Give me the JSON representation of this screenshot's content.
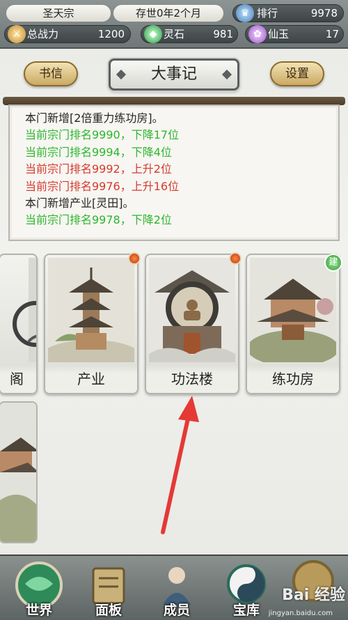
{
  "status": {
    "sect_name": "圣天宗",
    "era": "存世0年2个月",
    "rank_label": "排行",
    "rank_value": "9978",
    "power_label": "总战力",
    "power_value": "1200",
    "spirit_stone_label": "灵石",
    "spirit_stone_value": "981",
    "immortal_jade_label": "仙玉",
    "immortal_jade_value": "17"
  },
  "header": {
    "letters_label": "书信",
    "title": "大事记",
    "settings_label": "设置"
  },
  "events": [
    {
      "text": "本门新增[2倍重力练功房]。",
      "color": "black"
    },
    {
      "text": "当前宗门排名9990，下降17位",
      "color": "green"
    },
    {
      "text": "当前宗门排名9994，下降4位",
      "color": "green"
    },
    {
      "text": "当前宗门排名9992，上升2位",
      "color": "red"
    },
    {
      "text": "当前宗门排名9976，上升16位",
      "color": "red"
    },
    {
      "text": "本门新增产业[灵田]。",
      "color": "black"
    },
    {
      "text": "当前宗门排名9978，下降2位",
      "color": "green"
    }
  ],
  "buildings": {
    "partial_label": "阁",
    "industry_label": "产业",
    "technique_label": "功法楼",
    "training_label": "练功房",
    "build_badge": "建"
  },
  "nav": {
    "world": "世界",
    "panel": "面板",
    "members": "成员",
    "treasury": "宝库",
    "watermark": "Bai 经验",
    "watermark_sub": "jingyan.baidu.com"
  },
  "colors": {
    "green_text": "#2fb52f",
    "red_text": "#d53a2d",
    "arrow": "#e53935"
  }
}
